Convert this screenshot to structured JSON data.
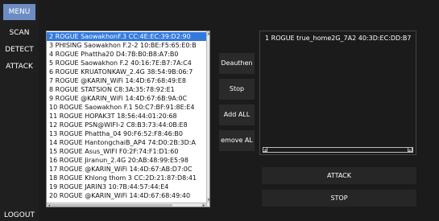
{
  "sidebar": {
    "menu_label": "MENU",
    "items": [
      "SCAN",
      "DETECT",
      "ATTACK"
    ],
    "logout_label": "LOGOUT"
  },
  "networks": [
    "2 ROGUE  SaowakhonF.3  CC:4E:EC:39:D2:90",
    "3 PHISING  Saowakhon F.2-2  10:BE:F5:65:E0:B",
    "4 ROGUE  Phattha20  D4:7B:B0:B8:A7:B0",
    "5 ROGUE  Saowakhon F.2  40:16:7E:B7:7A:C4",
    "6 ROGUE  KRUATONKAW_2.4G  38:54:9B:06:7",
    "7 ROGUE  @KARIN_WiFi  14:4D:67:68:49:E8",
    "8 ROGUE STATSION  C8:3A:35:78:92:E1",
    "9 ROGUE  @KARIN_WiFi  14:4D:67:6B:9A:0C",
    "10 ROGUE  Saowakhon F.1  50:C7:BF:91:8E:E4",
    "11 ROGUE  HOPAK3T  18:56:44:01:20:68",
    "12 ROGUE  PSN@WIFI-2  C8:B3:73:44:0B:E8",
    "13 ROGUE  Phattha_04  90:F6:52:F8:46:B0",
    "14 ROGUE  HantongchaiB_AP4  74:D0:2B:3D:A",
    "15 ROGUE  Asus_WIFI  F0:2F:74:F1:D1:60",
    "16 ROGUE  Jiranun_2.4G  20:AB:48:99:E5:98",
    "17 ROGUE  @KARIN_WiFi  14:4D:67:AB:D7:0C",
    "18 ROGUE  Khlong thom 3  CC:2D:21:87:D8:41",
    "19 ROGUE  JARIN3  10:7B:44:57:44:E4",
    "20 ROGUE  @KARIN_WiFi  14:4D:67:68:49:40"
  ],
  "selected_index": 0,
  "buttons": {
    "deauthen": "Deauthen",
    "stop": "Stop",
    "add_all": "Add ALL",
    "remove_all": "emove AL"
  },
  "targets": [
    "1 ROGUE  true_home2G_7A2  40:3D:EC:DD:B7"
  ],
  "actions": {
    "attack": "ATTACK",
    "stop": "STOP"
  },
  "colors": {
    "selection": "#3379dd",
    "menu_active": "#6e8cc4",
    "border": "#a9d8c9"
  }
}
